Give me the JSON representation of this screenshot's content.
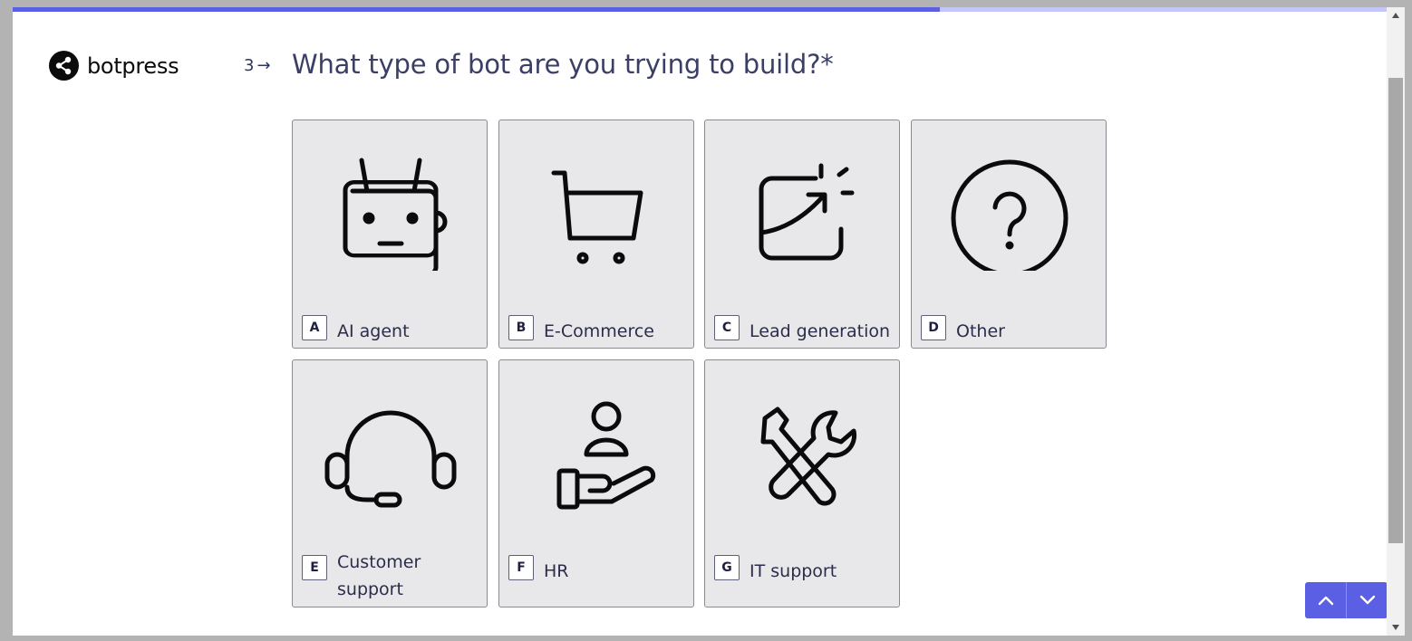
{
  "progress": {
    "fraction": 0.675
  },
  "brand": {
    "name": "botpress"
  },
  "question": {
    "number": "3",
    "arrow": "→",
    "text": "What type of bot are you trying to build?*"
  },
  "options": [
    {
      "key": "A",
      "label": "AI agent",
      "icon": "robot-icon"
    },
    {
      "key": "B",
      "label": "E-Commerce",
      "icon": "cart-icon"
    },
    {
      "key": "C",
      "label": "Lead generation",
      "icon": "growth-chart-icon"
    },
    {
      "key": "D",
      "label": "Other",
      "icon": "question-mark-icon"
    },
    {
      "key": "E",
      "label": "Customer support",
      "icon": "headset-icon"
    },
    {
      "key": "F",
      "label": "HR",
      "icon": "hand-person-icon"
    },
    {
      "key": "G",
      "label": "IT support",
      "icon": "tools-icon"
    }
  ],
  "colors": {
    "accent": "#5b5fe3",
    "card_bg": "#e8e8ea",
    "text": "#3b3f66"
  }
}
